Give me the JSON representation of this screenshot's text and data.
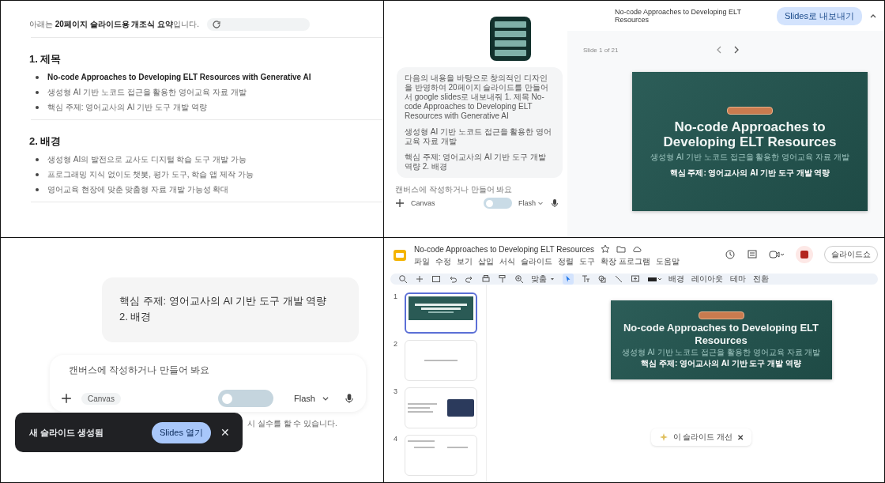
{
  "summary": {
    "intro": "아래는 **20페이지 슬라이드용 개조식 요약**입니다.",
    "sections": [
      {
        "heading": "1. 제목",
        "bullets": [
          {
            "text": "No-code Approaches to Developing ELT Resources with Generative AI",
            "bold": true
          },
          {
            "text": "생성형 AI 기반 노코드 접근을 활용한 영어교육 자료 개발",
            "bold": false
          },
          {
            "text": "핵심 주제: 영어교사의 AI 기반 도구 개발 역량",
            "bold": false
          }
        ]
      },
      {
        "heading": "2. 배경",
        "bullets": [
          {
            "text": "생성형 AI의 발전으로 교사도 디지털 학습 도구 개발 가능",
            "bold": false
          },
          {
            "text": "프로그래밍 지식 없이도 챗봇, 평가 도구, 학습 앱 제작 가능",
            "bold": false
          },
          {
            "text": "영어교육 현장에 맞춘 맞춤형 자료 개발 가능성 확대",
            "bold": false
          }
        ]
      }
    ]
  },
  "canvas_view": {
    "user_message": [
      "다음의 내용을 바탕으로 창의적인 디자인을 반영하여 20페이지 슬라이드를 만들어서 google slides로 내보내줘 1. 제목 No-code Approaches to Developing ELT Resources with Generative AI",
      "생성형 AI 기반 노코드 접근을 활용한 영어교육 자료 개발",
      "핵심 주제: 영어교사의 AI 기반 도구 개발 역량 2. 배경"
    ],
    "placeholder": "캔버스에 작성하거나 만들어 봐요",
    "canvas_chip": "Canvas",
    "model": "Flash",
    "doc_title": "No-code Approaches to Developing ELT Resources",
    "export_button": "Slides로 내보내기",
    "slide_counter": "Slide 1 of 21",
    "slide": {
      "title": "No-code Approaches to Developing ELT Resources",
      "subtitle": "생성형 AI 기반 노코드 접근을 활용한 영어교육 자료 개발",
      "tagline": "핵심 주제: 영어교사의 AI 기반 도구 개발 역량"
    }
  },
  "chat_view": {
    "message_lines": [
      "핵심 주제: 영어교사의 AI 기반 도구 개발 역량",
      "2. 배경"
    ],
    "placeholder": "캔버스에 작성하거나 만들어 봐요",
    "canvas_chip": "Canvas",
    "model": "Flash",
    "disclaimer": "시 실수를 할 수 있습니다.",
    "snackbar": {
      "text": "새 슬라이드 생성됨",
      "action": "Slides 열기",
      "close": "✕"
    }
  },
  "slides_editor": {
    "doc_title": "No-code Approaches to Developing ELT Resources",
    "menu": [
      "파일",
      "수정",
      "보기",
      "삽입",
      "서식",
      "슬라이드",
      "정렬",
      "도구",
      "확장 프로그램",
      "도움말"
    ],
    "slideshow_button": "슬라이드쇼",
    "zoom": "맞춤",
    "toolbar_buttons": [
      "배경",
      "레이아웃",
      "테마",
      "전환"
    ],
    "thumbnails": [
      {
        "number": "1",
        "kind": "title",
        "selected": true
      },
      {
        "number": "2",
        "kind": "text",
        "selected": false
      },
      {
        "number": "3",
        "kind": "image",
        "selected": false
      },
      {
        "number": "4",
        "kind": "columns",
        "selected": false
      }
    ],
    "slide": {
      "title": "No-code Approaches to Developing ELT Resources",
      "subtitle": "생성형 AI 기반 노코드 접근을 활용한 영어교육 자료 개발",
      "tagline": "핵심 주제: 영어교사의 AI 기반 도구 개발 역량"
    },
    "suggestion": "이 슬라이드 개선",
    "suggestion_close": "✕"
  }
}
